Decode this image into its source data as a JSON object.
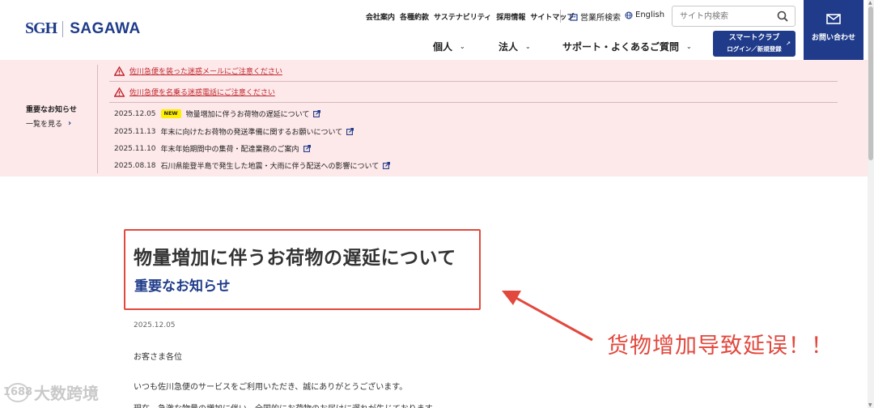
{
  "header": {
    "logo_mark": "SGH",
    "logo_text": "SAGAWA",
    "utility_links": [
      "会社案内",
      "各種約款",
      "サステナビリティ",
      "採用情報",
      "サイトマップ"
    ],
    "office_search": "営業所検索",
    "english": "English",
    "search_placeholder": "サイト内検索",
    "nav": [
      {
        "label": "個人"
      },
      {
        "label": "法人"
      },
      {
        "label": "サポート・よくあるご質問"
      }
    ],
    "smart_club_title": "スマートクラブ",
    "smart_club_sub": "ログイン／新規登録",
    "contact_label": "お問い合わせ"
  },
  "notice": {
    "heading": "重要なお知らせ",
    "more_label": "一覧を見る",
    "warnings": [
      "佐川急便を装った迷惑メールにご注意ください",
      "佐川急便を名乗る迷惑電話にご注意ください"
    ],
    "news": [
      {
        "date": "2025.12.05",
        "badge": "NEW",
        "title": "物量増加に伴うお荷物の遅延について"
      },
      {
        "date": "2025.11.13",
        "badge": "",
        "title": "年末に向けたお荷物の発送準備に関するお願いについて"
      },
      {
        "date": "2025.11.10",
        "badge": "",
        "title": "年末年始期間中の集荷・配達業務のご案内"
      },
      {
        "date": "2025.08.18",
        "badge": "",
        "title": "石川県能登半島で発生した地震・大雨に伴う配送への影響について"
      }
    ]
  },
  "article": {
    "title": "物量増加に伴うお荷物の遅延について",
    "category": "重要なお知らせ",
    "date": "2025.12.05",
    "greeting": "お客さま各位",
    "para1": "いつも佐川急便のサービスをご利用いただき、誠にありがとうございます。",
    "para2": "現在、急激な物量の増加に伴い、全国的にお荷物のお届けに遅れが生じております。"
  },
  "annotation": {
    "text": "货物增加导致延误！！",
    "color": "#e2483d"
  },
  "watermark": {
    "logo": "1688",
    "text": "大数跨境"
  },
  "colors": {
    "brand": "#1f3b8a",
    "notice_bg": "#fde8ea",
    "warning_red": "#c0272d",
    "new_badge": "#ffee00",
    "highlight": "#e2483d"
  }
}
